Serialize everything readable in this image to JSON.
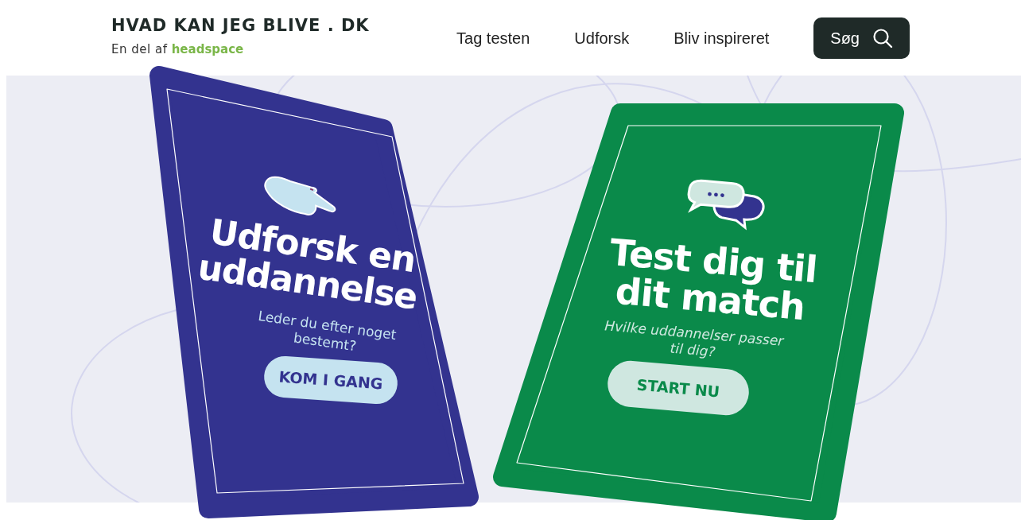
{
  "header": {
    "logo_title": "HVAD KAN JEG BLIVE . DK",
    "logo_prefix": "En del af",
    "logo_brand": "headspace"
  },
  "nav": [
    {
      "label": "Tag testen"
    },
    {
      "label": "Udforsk"
    },
    {
      "label": "Bliv inspireret"
    }
  ],
  "search_button": {
    "label": "Søg"
  },
  "cards": [
    {
      "kind": "explore",
      "title": "Udforsk en uddannelse",
      "subtitle": "Leder du efter noget bestemt?",
      "button": "KOM I GANG"
    },
    {
      "kind": "test",
      "title": "Test dig til dit match",
      "subtitle": "Hvilke uddannelser passer til dig?",
      "button": "START NU"
    }
  ]
}
